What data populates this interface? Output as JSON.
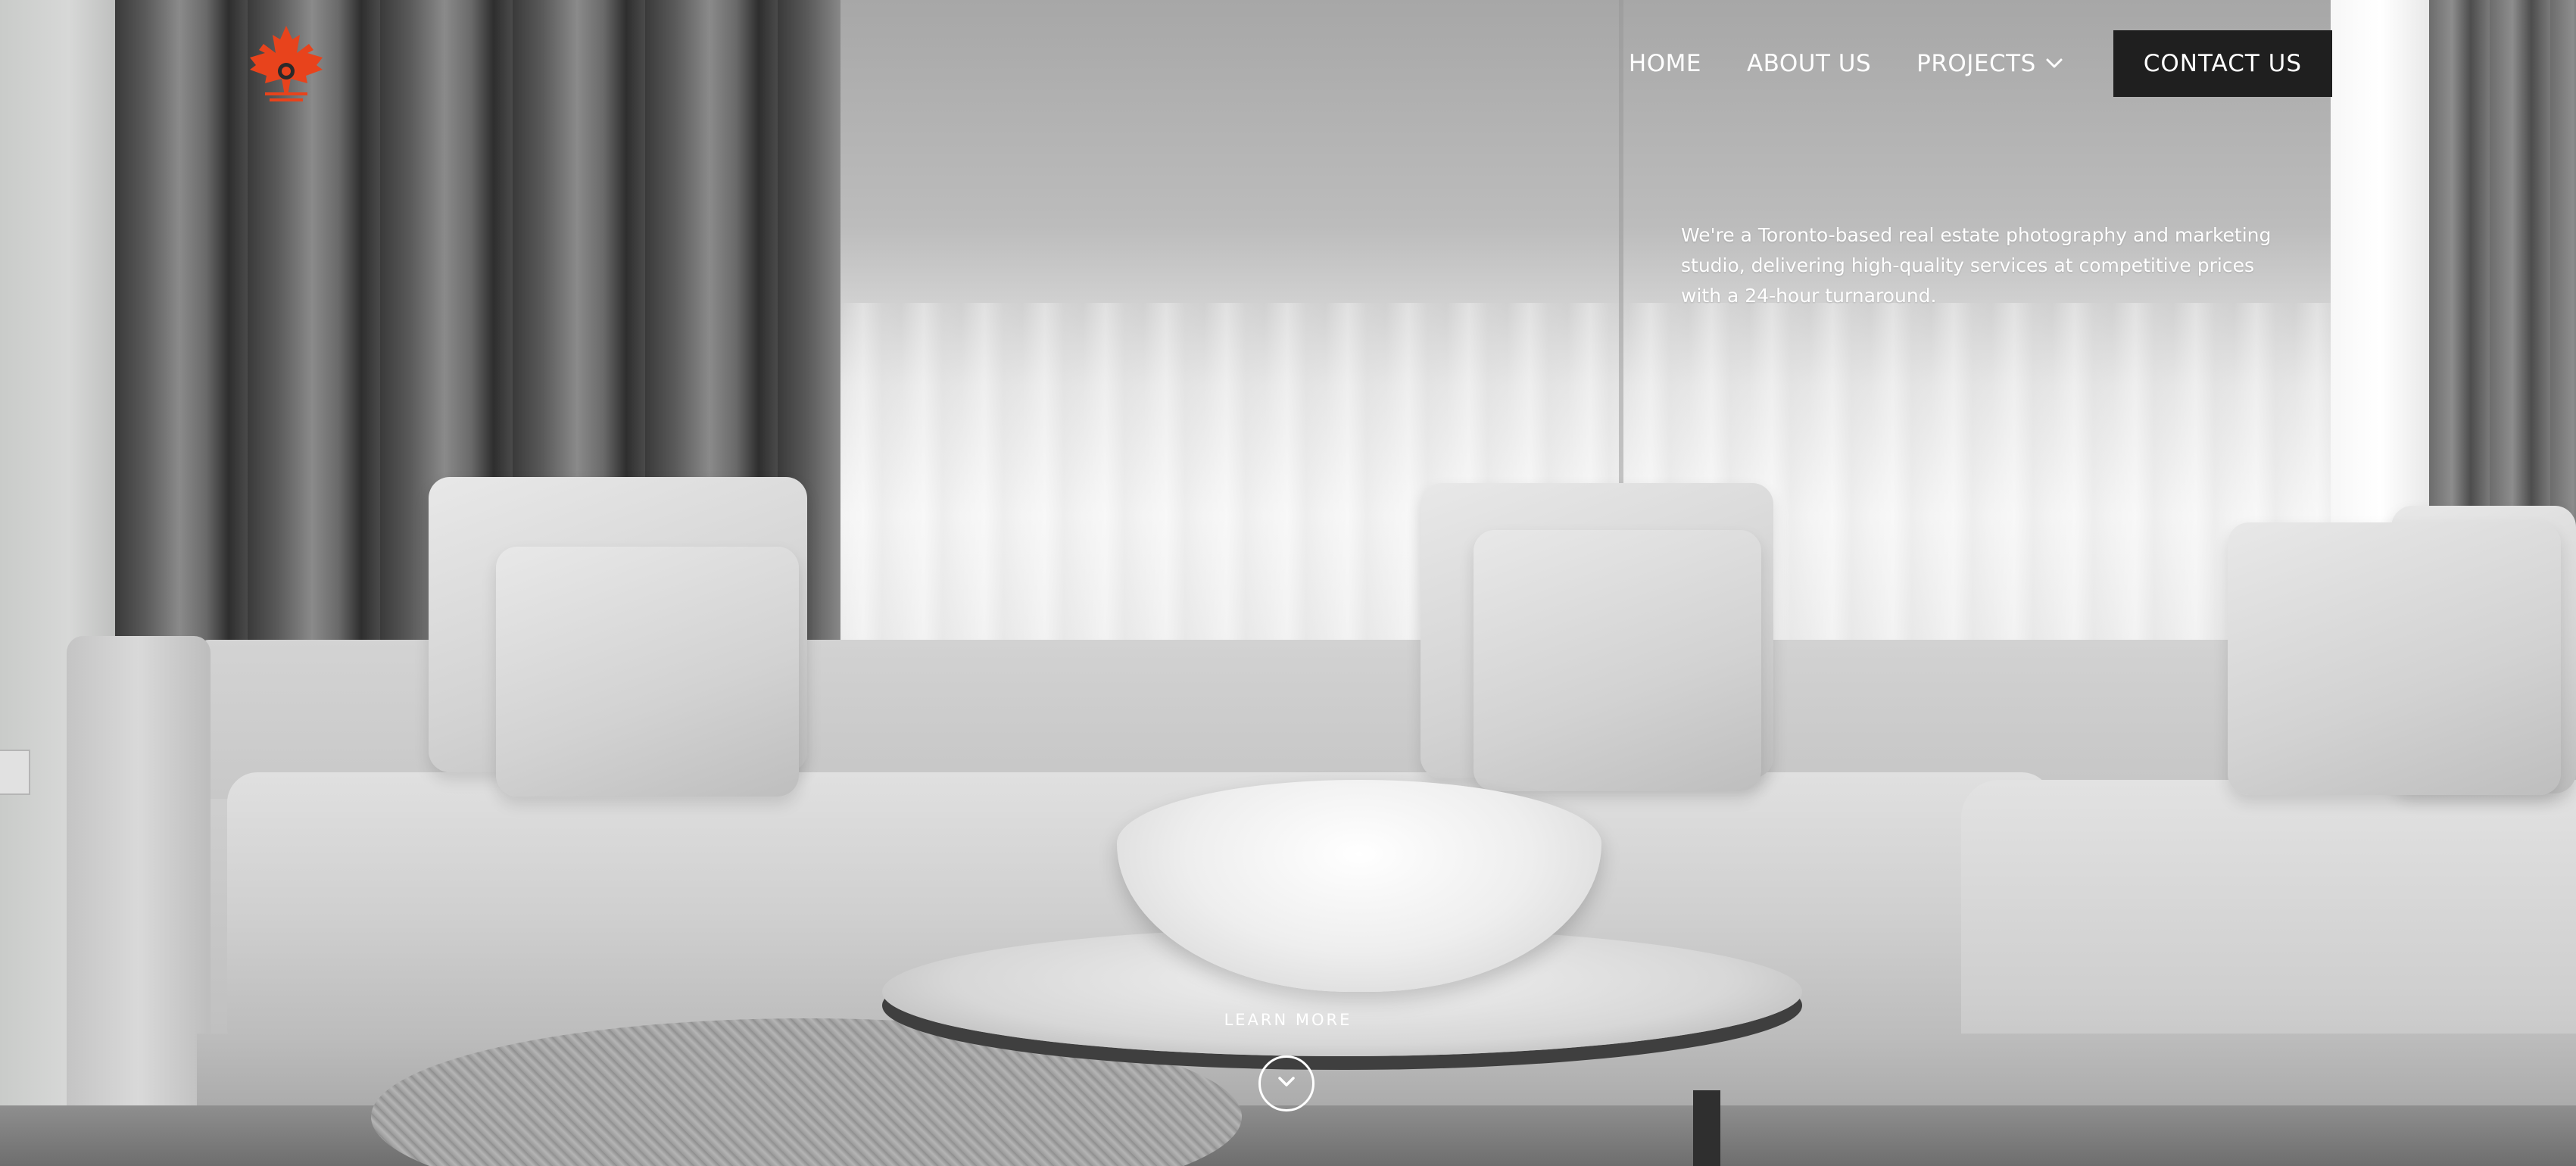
{
  "brand": {
    "logo_icon": "maple-leaf-icon",
    "accent_color": "#e8431c"
  },
  "nav": {
    "items": [
      {
        "label": "HOME"
      },
      {
        "label": "ABOUT US"
      },
      {
        "label": "PROJECTS",
        "icon": "chevron-down-icon"
      }
    ],
    "contact_label": "CONTACT US"
  },
  "hero": {
    "intro": "We're a Toronto-based real estate photography and marketing studio, delivering high-quality services at competitive prices with a 24-hour turnaround.",
    "learn_more_label": "LEARN MORE",
    "scroll_icon": "chevron-down-icon"
  }
}
